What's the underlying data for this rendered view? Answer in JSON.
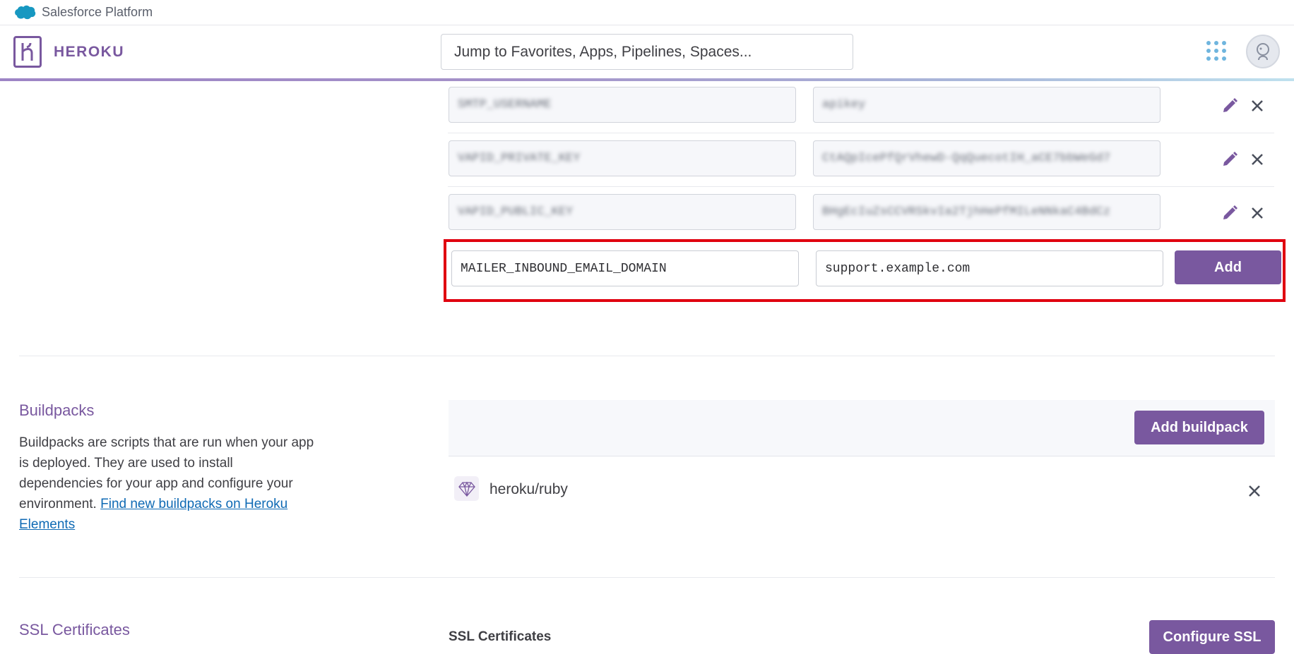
{
  "salesforce": {
    "label": "Salesforce Platform"
  },
  "header": {
    "brand": "HEROKU",
    "search_placeholder": "Jump to Favorites, Apps, Pipelines, Spaces..."
  },
  "config_vars": {
    "rows": [
      {
        "key": "SMTP_USERNAME",
        "value": "apikey"
      },
      {
        "key": "VAPID_PRIVATE_KEY",
        "value": "CtAQpIcePfQrVhewD-QqQuecotIH_aCE7bbWeGd7"
      },
      {
        "key": "VAPID_PUBLIC_KEY",
        "value": "BHgEcIuZsCCVRSkvIa2TjhHePfMILeNNkaC4BdCz"
      }
    ],
    "new_key": "MAILER_INBOUND_EMAIL_DOMAIN",
    "new_value": "support.example.com",
    "add_label": "Add"
  },
  "buildpacks": {
    "title": "Buildpacks",
    "description": "Buildpacks are scripts that are run when your app is deployed. They are used to install dependencies for your app and configure your environment.",
    "link_text": "Find new buildpacks on Heroku Elements",
    "add_label": "Add buildpack",
    "items": [
      {
        "name": "heroku/ruby"
      }
    ]
  },
  "ssl": {
    "title": "SSL Certificates",
    "subtitle": "SSL Certificates",
    "button_label": "Configure SSL"
  },
  "colors": {
    "accent": "#79589f",
    "highlight_border": "#e0000f",
    "link": "#0f6ab4"
  }
}
